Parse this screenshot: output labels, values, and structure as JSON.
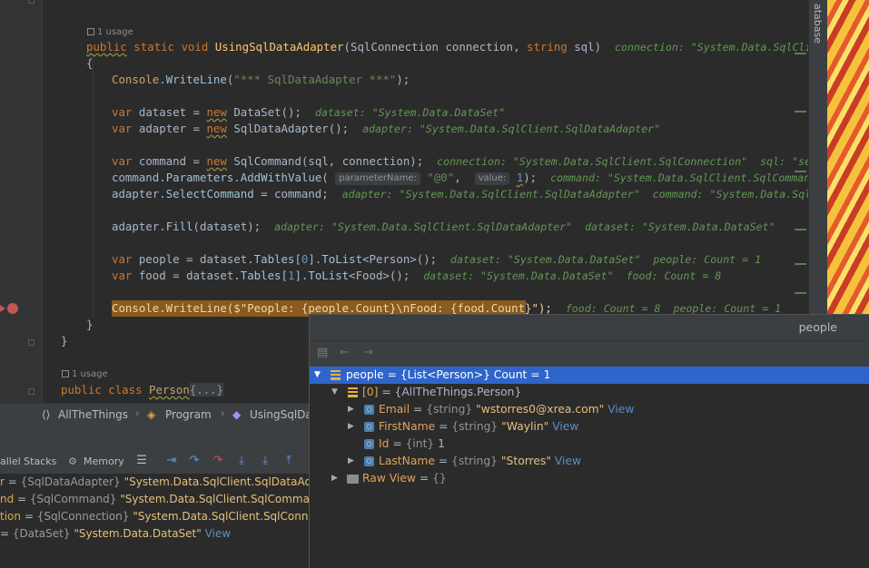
{
  "editor": {
    "usage1": "1 usage",
    "usage2": "1 usage",
    "lines": {
      "sig_public": "public",
      "sig_static": "static",
      "sig_void": "void",
      "sig_name": "UsingSqlDataAdapter",
      "sig_p1type": "SqlConnection",
      "sig_p1": "connection",
      "sig_p2type": "string",
      "sig_p2": "sql",
      "sig_hint": "connection: \"System.Data.SqlClient.S",
      "brace_open": "{",
      "cw1_obj": "Console",
      "cw1_fn": "WriteLine",
      "cw1_str": "\"*** SqlDataAdapter ***\"",
      "ds_var": "var",
      "ds_name": "dataset",
      "ds_new": "new",
      "ds_type": "DataSet",
      "ds_hint": "dataset: \"System.Data.DataSet\"",
      "ad_var": "var",
      "ad_name": "adapter",
      "ad_new": "new",
      "ad_type": "SqlDataAdapter",
      "ad_hint": "adapter: \"System.Data.SqlClient.SqlDataAdapter\"",
      "cmd_var": "var",
      "cmd_name": "command",
      "cmd_new": "new",
      "cmd_type": "SqlCommand",
      "cmd_args": "(sql, connection);",
      "cmd_hint": "connection: \"System.Data.SqlClient.SqlConnection\"  sql: \"sele",
      "par_obj": "command",
      "par_prop": "Parameters",
      "par_fn": "AddWithValue",
      "par_hint_name": "parameterName:",
      "par_str": "\"@0\"",
      "par_hint_value": "value:",
      "par_num": "1",
      "par_hint": "command: \"System.Data.SqlClient.SqlCommand\"",
      "sel_obj": "adapter",
      "sel_prop": "SelectCommand",
      "sel_rest": " = command;",
      "sel_hint": "adapter: \"System.Data.SqlClient.SqlDataAdapter\"  command: \"System.Data.SqlC",
      "fill_obj": "adapter",
      "fill_fn": "Fill",
      "fill_args": "(dataset);",
      "fill_hint": "adapter: \"System.Data.SqlClient.SqlDataAdapter\"  dataset: \"System.Data.DataSet\"",
      "pp_var": "var",
      "pp_rest1": " people = dataset.",
      "pp_tables": "Tables",
      "pp_idx": "[",
      "pp_num": "0",
      "pp_idx2": "].",
      "pp_fn": "ToList",
      "pp_gen": "<Person>();",
      "pp_hint": "dataset: \"System.Data.DataSet\"  people: Count = 1",
      "fd_var": "var",
      "fd_rest1": " food = dataset.",
      "fd_tables": "Tables",
      "fd_idx": "[",
      "fd_num": "1",
      "fd_idx2": "].",
      "fd_fn": "ToList",
      "fd_gen": "<Food>();",
      "fd_hint": "dataset: \"System.Data.DataSet\"  food: Count = 8",
      "exec_code": "Console.WriteLine($\"People: {people.Count}\\nFood: {food.Count}\");",
      "exec_hint": "food: Count = 8  people: Count = 1",
      "brace_close_inner": "}",
      "brace_close_outer": "}",
      "class_public": "public",
      "class_kw": "class",
      "class_name": "Person",
      "class_fold": "{...}"
    }
  },
  "side_tool": "atabase",
  "breadcrumb": {
    "items": [
      "AllTheThings",
      "Program",
      "UsingSqlDa"
    ]
  },
  "debug_toolbar": {
    "stacks_label": "allel Stacks",
    "memory_label": "Memory"
  },
  "variables": [
    {
      "name": "r",
      "type": "{SqlDataAdapter}",
      "value": "\"System.Data.SqlClient.SqlDataAda",
      "link": ""
    },
    {
      "name": "nd",
      "type": "{SqlCommand}",
      "value": "\"System.Data.SqlClient.SqlComman",
      "link": ""
    },
    {
      "name": "tion",
      "type": "{SqlConnection}",
      "value": "\"System.Data.SqlClient.SqlConn",
      "link": ""
    },
    {
      "name": "",
      "type": "{DataSet}",
      "value": "\"System.Data.DataSet\"",
      "link": "View"
    }
  ],
  "popup": {
    "title": "people",
    "tree": [
      {
        "name": "people",
        "eq": " = ",
        "type": "{List<Person>}",
        "value": " Count = 1",
        "link": ""
      },
      {
        "name": "[0]",
        "eq": " = ",
        "type": "{AllTheThings.Person}",
        "value": "",
        "link": ""
      },
      {
        "name": "Email",
        "eq": " = ",
        "type": "{string}",
        "value": "\"wstorres0@xrea.com\"",
        "link": "View"
      },
      {
        "name": "FirstName",
        "eq": " = ",
        "type": "{string}",
        "value": "\"Waylin\"",
        "link": "View"
      },
      {
        "name": "Id",
        "eq": " = ",
        "type": "{int}",
        "value": "1",
        "link": ""
      },
      {
        "name": "LastName",
        "eq": " = ",
        "type": "{string}",
        "value": "\"Storres\"",
        "link": "View"
      },
      {
        "name": "Raw View",
        "eq": " = ",
        "type": "{}",
        "value": "",
        "link": ""
      }
    ]
  },
  "colors": {
    "editor_bg": "#2b2b2b",
    "selection": "#2f65ca",
    "exec_highlight": "#8a5a1e",
    "keyword": "#cc7832",
    "string": "#6a8759",
    "hint": "#629755"
  }
}
